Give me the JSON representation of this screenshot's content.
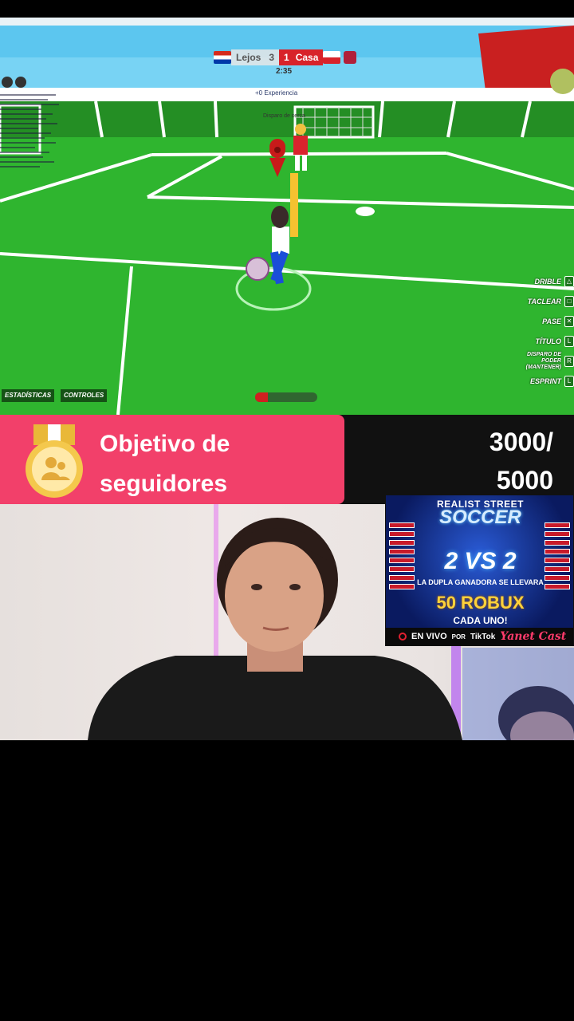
{
  "game": {
    "scoreboard": {
      "away_team": "Lejos",
      "away_score": "3",
      "home_score": "1",
      "home_team": "Casa",
      "clock": "2:35"
    },
    "event_text": "+0 Experiencia",
    "nearby_text": "Disparo de cerca",
    "controls": [
      {
        "label": "DRIBLE",
        "key": "△"
      },
      {
        "label": "TACLEAR",
        "key": "□"
      },
      {
        "label": "PASE",
        "key": "✕"
      },
      {
        "label": "TÍTULO",
        "key": "L"
      },
      {
        "label": "DISPARO DE PODER (MANTENER)",
        "key": "R"
      },
      {
        "label": "ESPRINT",
        "key": "L"
      }
    ],
    "stats_button": "ESTADÍSTICAS",
    "controls_button": "CONTROLES",
    "stamina_fraction": 0.2
  },
  "goal": {
    "title": "Objetivo de seguidores",
    "count": "3000/ 5000",
    "current": 3000,
    "target": 5000
  },
  "poster": {
    "title_line1": "REALIST STREET",
    "title_line2": "SOCCER",
    "matchup": "2 VS 2",
    "subtitle": "LA DUPLA GANADORA SE LLEVARA",
    "prize": "50 ROBUX",
    "each": "CADA UNO!",
    "live": "EN VIVO",
    "by": "POR",
    "platform": "TikTok",
    "creator": "Yanet Cast"
  },
  "colors": {
    "goal_pink": "#f2406a",
    "field_green": "#2fb52f",
    "score_red": "#d8232a"
  }
}
